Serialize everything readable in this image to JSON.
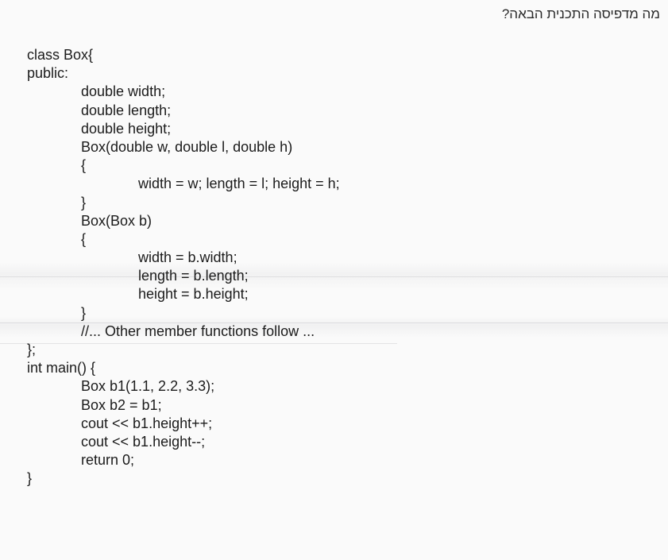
{
  "question": "מה מדפיסה התכנית הבאה?",
  "code_lines": [
    {
      "indent": 0,
      "text": "class Box{"
    },
    {
      "indent": 0,
      "text": "public:"
    },
    {
      "indent": 1,
      "text": "double width;"
    },
    {
      "indent": 1,
      "text": "double length;"
    },
    {
      "indent": 1,
      "text": "double height;"
    },
    {
      "indent": 1,
      "text": "Box(double w, double l, double h)"
    },
    {
      "indent": 1,
      "text": "{"
    },
    {
      "indent": 2,
      "text": "width = w; length = l; height = h;"
    },
    {
      "indent": 1,
      "text": "}"
    },
    {
      "indent": 1,
      "text": "Box(Box b)"
    },
    {
      "indent": 1,
      "text": "{"
    },
    {
      "indent": 2,
      "text": "width = b.width;"
    },
    {
      "indent": 2,
      "text": "length = b.length;"
    },
    {
      "indent": 2,
      "text": "height = b.height;"
    },
    {
      "indent": 1,
      "text": "}"
    },
    {
      "indent": 1,
      "text": "//... Other member functions follow ..."
    },
    {
      "indent": 0,
      "text": "};"
    },
    {
      "indent": 0,
      "text": "int main() {"
    },
    {
      "indent": 1,
      "text": "Box b1(1.1, 2.2, 3.3);"
    },
    {
      "indent": 1,
      "text": "Box b2 = b1;"
    },
    {
      "indent": 1,
      "text": "cout << b1.height++;"
    },
    {
      "indent": 1,
      "text": "cout << b1.height--;"
    },
    {
      "indent": 1,
      "text": "return 0;"
    },
    {
      "indent": 0,
      "text": "}"
    }
  ]
}
